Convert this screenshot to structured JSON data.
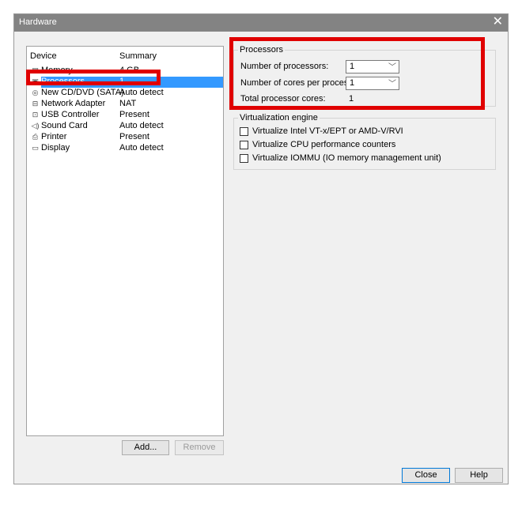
{
  "window": {
    "title": "Hardware",
    "close_glyph": "✕"
  },
  "device_list": {
    "headers": {
      "device": "Device",
      "summary": "Summary"
    },
    "items": [
      {
        "name": "Memory",
        "summary": "4 GB",
        "icon": "memory-icon"
      },
      {
        "name": "Processors",
        "summary": "1",
        "icon": "processor-icon",
        "selected": true
      },
      {
        "name": "New CD/DVD (SATA)",
        "summary": "Auto detect",
        "icon": "cd-icon"
      },
      {
        "name": "Network Adapter",
        "summary": "NAT",
        "icon": "network-icon"
      },
      {
        "name": "USB Controller",
        "summary": "Present",
        "icon": "usb-icon"
      },
      {
        "name": "Sound Card",
        "summary": "Auto detect",
        "icon": "sound-icon"
      },
      {
        "name": "Printer",
        "summary": "Present",
        "icon": "printer-icon"
      },
      {
        "name": "Display",
        "summary": "Auto detect",
        "icon": "display-icon"
      }
    ],
    "add_label": "Add...",
    "remove_label": "Remove"
  },
  "processors": {
    "legend": "Processors",
    "num_processors_label": "Number of processors:",
    "num_processors_value": "1",
    "cores_label": "Number of cores per processor:",
    "cores_value": "1",
    "total_label": "Total processor cores:",
    "total_value": "1"
  },
  "virtualization": {
    "legend": "Virtualization engine",
    "options": [
      {
        "label": "Virtualize Intel VT-x/EPT or AMD-V/RVI",
        "checked": false
      },
      {
        "label": "Virtualize CPU performance counters",
        "checked": false
      },
      {
        "label": "Virtualize IOMMU (IO memory management unit)",
        "checked": false
      }
    ]
  },
  "footer": {
    "close_label": "Close",
    "help_label": "Help"
  },
  "colors": {
    "highlight": "#e00000",
    "selection": "#3399ff",
    "titlebar": "#838383"
  }
}
